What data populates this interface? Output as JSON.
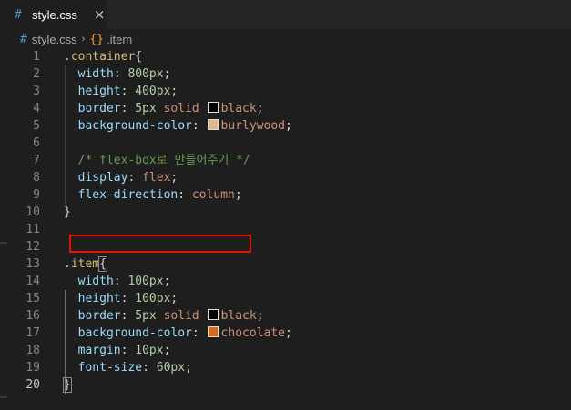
{
  "tab": {
    "icon": "css-hash-icon",
    "hash": "#",
    "title": "style.css",
    "close": "×"
  },
  "breadcrumb": {
    "hash": "#",
    "file": "style.css",
    "separator": "›",
    "symbol_icon": "css-selector-icon",
    "symbol_glyph": "{}",
    "symbol": ".item"
  },
  "colors": {
    "burlywood": "#deb887",
    "black": "#000000",
    "chocolate": "#d2691e",
    "highlight": "#e51400"
  },
  "lines": [
    {
      "n": "1",
      "tokens": [
        {
          "t": ".container",
          "c": "sel"
        },
        {
          "t": "{",
          "c": "punc"
        }
      ]
    },
    {
      "n": "2",
      "tokens": [
        {
          "t": "  ",
          "c": "punc"
        },
        {
          "t": "width",
          "c": "prop"
        },
        {
          "t": ": ",
          "c": "punc"
        },
        {
          "t": "800px",
          "c": "num"
        },
        {
          "t": ";",
          "c": "punc"
        }
      ]
    },
    {
      "n": "3",
      "tokens": [
        {
          "t": "  ",
          "c": "punc"
        },
        {
          "t": "height",
          "c": "prop"
        },
        {
          "t": ": ",
          "c": "punc"
        },
        {
          "t": "400px",
          "c": "num"
        },
        {
          "t": ";",
          "c": "punc"
        }
      ]
    },
    {
      "n": "4",
      "tokens": [
        {
          "t": "  ",
          "c": "punc"
        },
        {
          "t": "border",
          "c": "prop"
        },
        {
          "t": ": ",
          "c": "punc"
        },
        {
          "t": "5px",
          "c": "num"
        },
        {
          "t": " ",
          "c": "punc"
        },
        {
          "t": "solid",
          "c": "val"
        },
        {
          "t": " ",
          "c": "punc"
        },
        {
          "sw": "black"
        },
        {
          "t": "black",
          "c": "val"
        },
        {
          "t": ";",
          "c": "punc"
        }
      ]
    },
    {
      "n": "5",
      "tokens": [
        {
          "t": "  ",
          "c": "punc"
        },
        {
          "t": "background-color",
          "c": "prop"
        },
        {
          "t": ": ",
          "c": "punc"
        },
        {
          "sw": "burlywood"
        },
        {
          "t": "burlywood",
          "c": "val"
        },
        {
          "t": ";",
          "c": "punc"
        }
      ]
    },
    {
      "n": "6",
      "tokens": []
    },
    {
      "n": "7",
      "tokens": [
        {
          "t": "  ",
          "c": "punc"
        },
        {
          "t": "/* flex-box로 만들어주기 */",
          "c": "comment"
        }
      ]
    },
    {
      "n": "8",
      "tokens": [
        {
          "t": "  ",
          "c": "punc"
        },
        {
          "t": "display",
          "c": "prop"
        },
        {
          "t": ": ",
          "c": "punc"
        },
        {
          "t": "flex",
          "c": "val"
        },
        {
          "t": ";",
          "c": "punc"
        }
      ]
    },
    {
      "n": "9",
      "tokens": [
        {
          "t": "  ",
          "c": "punc"
        },
        {
          "t": "flex-direction",
          "c": "prop"
        },
        {
          "t": ": ",
          "c": "punc"
        },
        {
          "t": "column",
          "c": "val"
        },
        {
          "t": ";",
          "c": "punc"
        }
      ]
    },
    {
      "n": "10",
      "tokens": [
        {
          "t": "}",
          "c": "punc"
        }
      ]
    },
    {
      "n": "11",
      "tokens": []
    },
    {
      "n": "12",
      "tokens": []
    },
    {
      "n": "13",
      "tokens": [
        {
          "t": ".item",
          "c": "sel"
        },
        {
          "t": "{",
          "c": "punc",
          "bm": true
        }
      ]
    },
    {
      "n": "14",
      "tokens": [
        {
          "t": "  ",
          "c": "punc"
        },
        {
          "t": "width",
          "c": "prop"
        },
        {
          "t": ": ",
          "c": "punc"
        },
        {
          "t": "100px",
          "c": "num"
        },
        {
          "t": ";",
          "c": "punc"
        }
      ]
    },
    {
      "n": "15",
      "tokens": [
        {
          "t": "  ",
          "c": "punc"
        },
        {
          "t": "height",
          "c": "prop"
        },
        {
          "t": ": ",
          "c": "punc"
        },
        {
          "t": "100px",
          "c": "num"
        },
        {
          "t": ";",
          "c": "punc"
        }
      ]
    },
    {
      "n": "16",
      "tokens": [
        {
          "t": "  ",
          "c": "punc"
        },
        {
          "t": "border",
          "c": "prop"
        },
        {
          "t": ": ",
          "c": "punc"
        },
        {
          "t": "5px",
          "c": "num"
        },
        {
          "t": " ",
          "c": "punc"
        },
        {
          "t": "solid",
          "c": "val"
        },
        {
          "t": " ",
          "c": "punc"
        },
        {
          "sw": "black"
        },
        {
          "t": "black",
          "c": "val"
        },
        {
          "t": ";",
          "c": "punc"
        }
      ]
    },
    {
      "n": "17",
      "tokens": [
        {
          "t": "  ",
          "c": "punc"
        },
        {
          "t": "background-color",
          "c": "prop"
        },
        {
          "t": ": ",
          "c": "punc"
        },
        {
          "sw": "chocolate"
        },
        {
          "t": "chocolate",
          "c": "val"
        },
        {
          "t": ";",
          "c": "punc"
        }
      ]
    },
    {
      "n": "18",
      "tokens": [
        {
          "t": "  ",
          "c": "punc"
        },
        {
          "t": "margin",
          "c": "prop"
        },
        {
          "t": ": ",
          "c": "punc"
        },
        {
          "t": "10px",
          "c": "num"
        },
        {
          "t": ";",
          "c": "punc"
        }
      ]
    },
    {
      "n": "19",
      "tokens": [
        {
          "t": "  ",
          "c": "punc"
        },
        {
          "t": "font-size",
          "c": "prop"
        },
        {
          "t": ": ",
          "c": "punc"
        },
        {
          "t": "60px",
          "c": "num"
        },
        {
          "t": ";",
          "c": "punc"
        }
      ]
    },
    {
      "n": "20",
      "tokens": [
        {
          "t": "}",
          "c": "punc",
          "bm": true
        }
      ],
      "active": true
    }
  ]
}
